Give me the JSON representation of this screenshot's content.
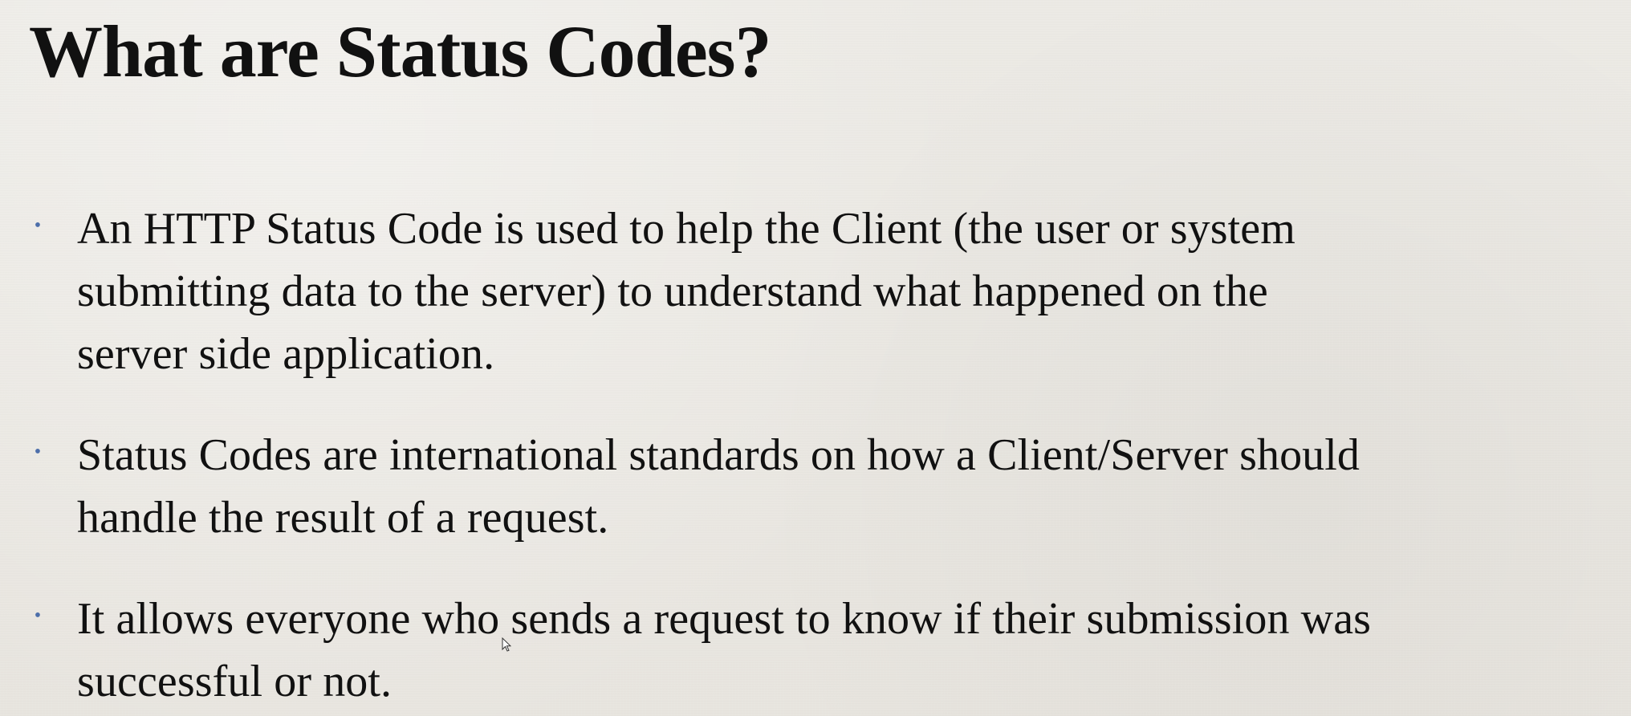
{
  "slide": {
    "title": "What are Status Codes?",
    "bullets": [
      {
        "lines": [
          "An HTTP Status Code is used to help the Client (the user or system",
          "submitting data to the server) to understand what happened on the",
          "server side application."
        ]
      },
      {
        "lines": [
          "Status Codes are international standards on how a Client/Server should",
          "handle the result of a request."
        ]
      },
      {
        "lines": [
          "It allows everyone who sends a request to know if their submission was",
          "successful or not."
        ]
      }
    ]
  },
  "icons": {
    "bullet": "bullet-icon",
    "cursor": "mouse-cursor-icon"
  },
  "colors": {
    "background": "#ebe8e2",
    "text": "#111111",
    "bullet": "#4d6faa"
  }
}
